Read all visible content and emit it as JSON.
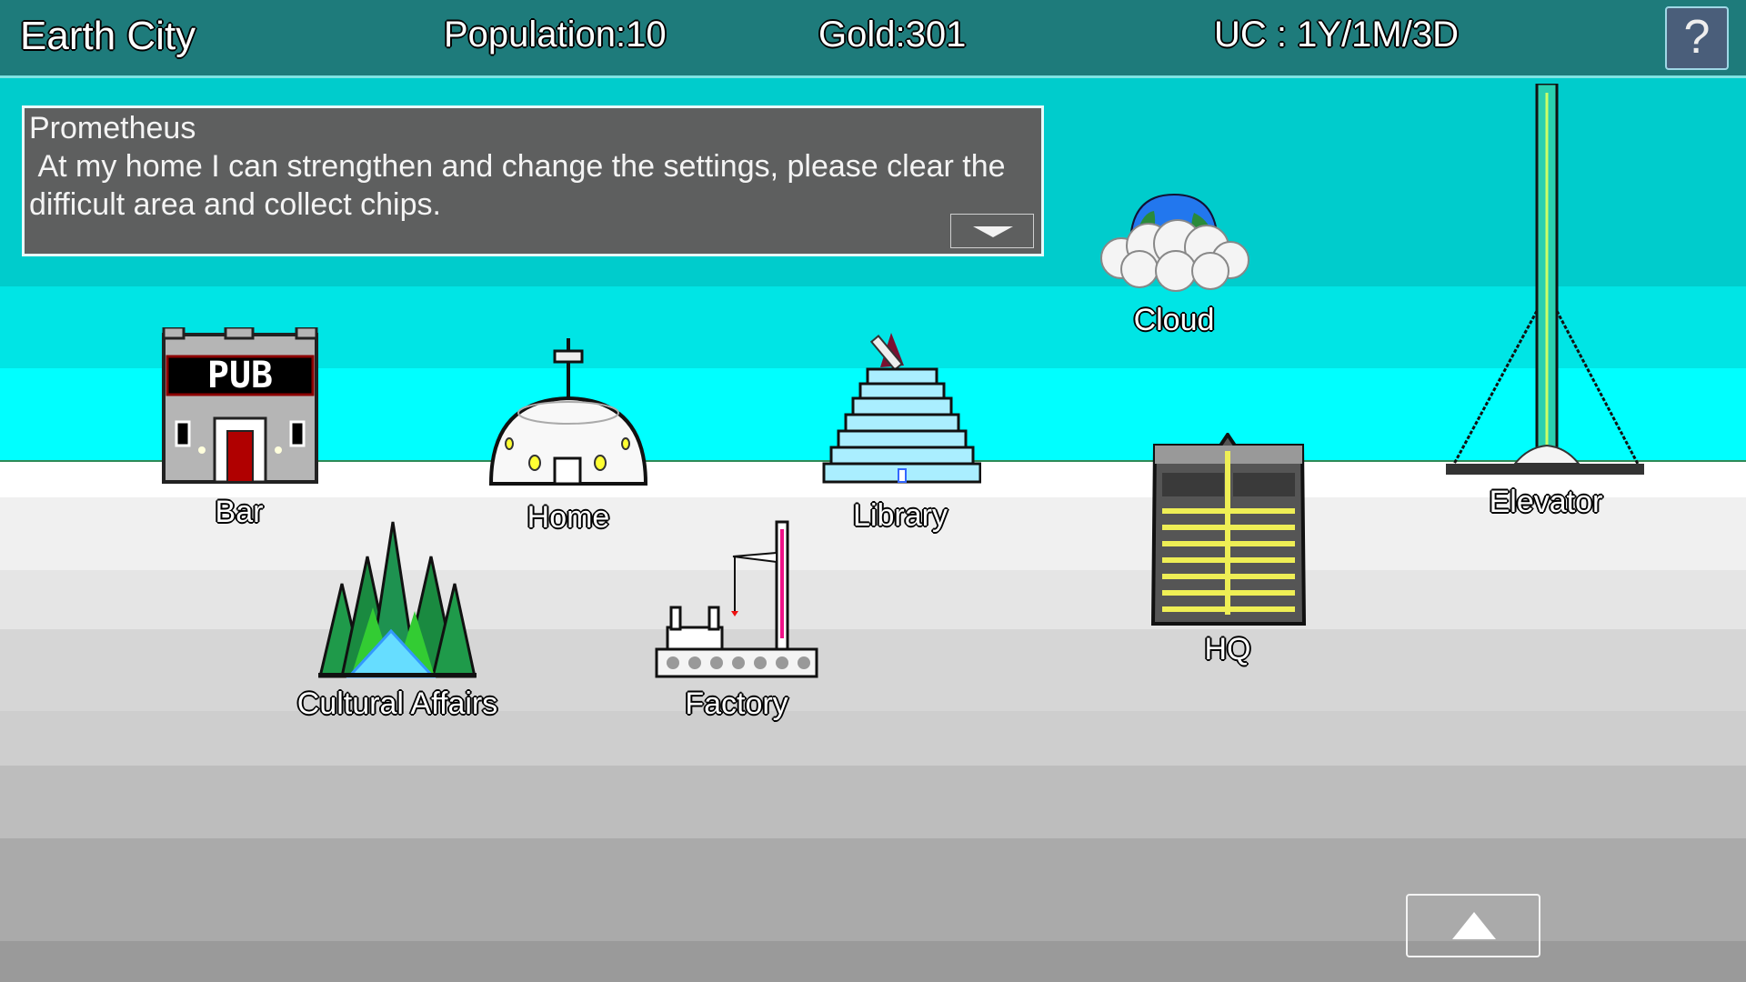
{
  "header": {
    "city_name": "Earth City",
    "population": "Population:10",
    "gold": "Gold:301",
    "date": "UC : 1Y/1M/3D",
    "help_label": "?"
  },
  "dialog": {
    "speaker": "Prometheus",
    "message": " At my home I can strengthen and change the settings, please clear the difficult area and collect chips.",
    "next_icon": "chevron-down-icon"
  },
  "buildings": [
    {
      "label": "Bar",
      "sign": "PUB",
      "icon": "pub-building-icon"
    },
    {
      "label": "Home",
      "icon": "dome-house-icon"
    },
    {
      "label": "Library",
      "icon": "stepped-pyramid-library-icon"
    },
    {
      "label": "Cloud",
      "icon": "globe-on-cloud-icon"
    },
    {
      "label": "Elevator",
      "icon": "space-elevator-tower-icon"
    },
    {
      "label": "HQ",
      "icon": "circuit-board-hq-icon"
    },
    {
      "label": "Cultural Affairs",
      "icon": "forest-pyramid-icon"
    },
    {
      "label": "Factory",
      "icon": "crane-factory-icon"
    }
  ],
  "footer": {
    "scroll_up_icon": "triangle-up-icon"
  },
  "colors": {
    "topbar": "#1e7b7b",
    "sky": [
      "#00cccc",
      "#00e5e5",
      "#00ffff"
    ],
    "ground": [
      "#ffffff",
      "#f0f0f0",
      "#e5e5e5",
      "#d6d6d6",
      "#cecece",
      "#bdbdbd",
      "#aaaaaa",
      "#9a9a9a"
    ],
    "dialog_bg": "#5e5f5f",
    "help_bg": "#4a5e7a"
  }
}
